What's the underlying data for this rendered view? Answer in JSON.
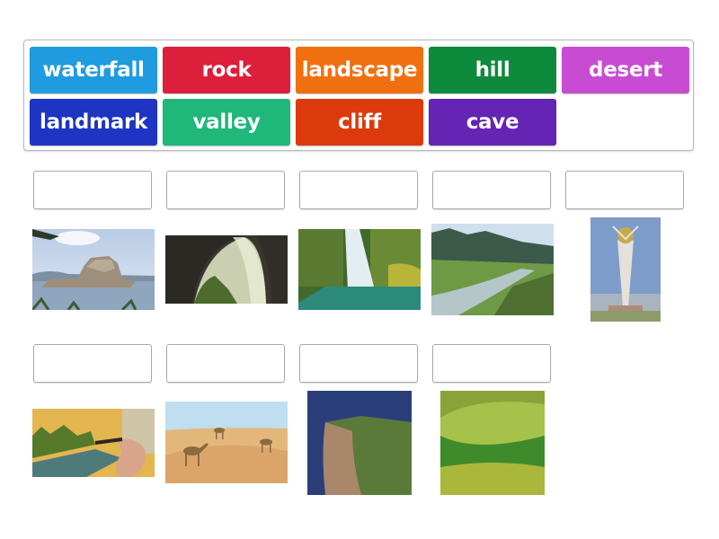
{
  "word_bank": {
    "tiles": [
      {
        "label": "waterfall",
        "color": "#1f9be0"
      },
      {
        "label": "rock",
        "color": "#dc1f3a"
      },
      {
        "label": "landscape",
        "color": "#f07010"
      },
      {
        "label": "hill",
        "color": "#0e8a3c"
      },
      {
        "label": "desert",
        "color": "#c84cd2"
      },
      {
        "label": "landmark",
        "color": "#1d35c2"
      },
      {
        "label": "valley",
        "color": "#1fb87a"
      },
      {
        "label": "cliff",
        "color": "#dc3a0c"
      },
      {
        "label": "cave",
        "color": "#6424b4"
      }
    ]
  },
  "targets": [
    {
      "image": "rock-formation-in-lake",
      "answer": ""
    },
    {
      "image": "cave-opening-with-light",
      "answer": ""
    },
    {
      "image": "waterfall-into-pool",
      "answer": ""
    },
    {
      "image": "river-valley-mountains",
      "answer": ""
    },
    {
      "image": "tall-tower-landmark",
      "answer": ""
    },
    {
      "image": "painting-landscape-brush",
      "answer": ""
    },
    {
      "image": "desert-with-camels",
      "answer": ""
    },
    {
      "image": "sea-cliff",
      "answer": ""
    },
    {
      "image": "green-rolling-hills",
      "answer": ""
    }
  ]
}
